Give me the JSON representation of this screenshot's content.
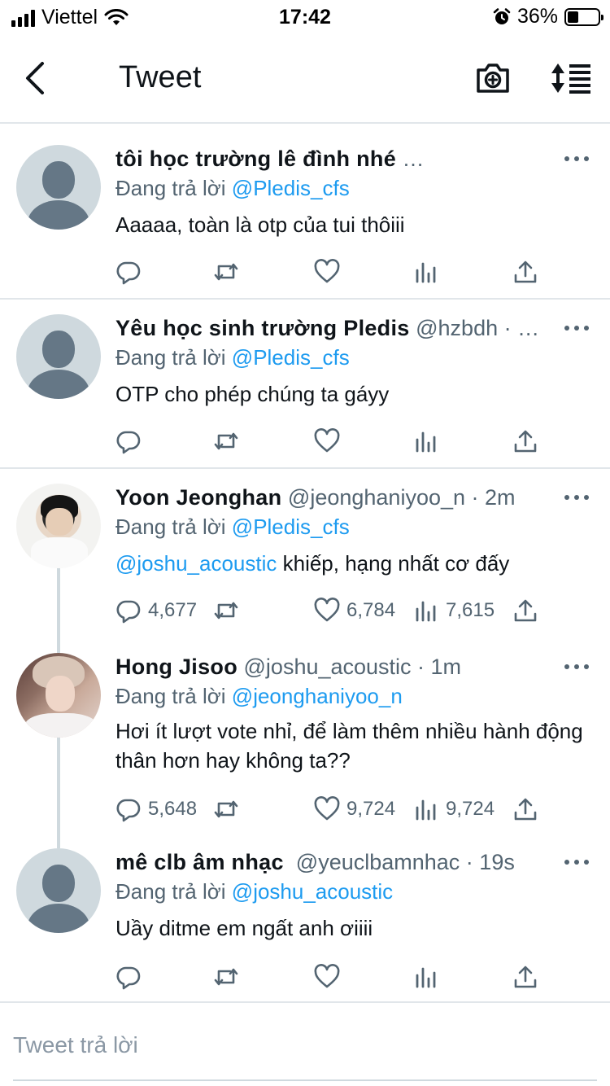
{
  "status_bar": {
    "carrier": "Viettel",
    "time": "17:42",
    "battery_percent": "36%",
    "battery_level": 0.36
  },
  "header": {
    "title": "Tweet",
    "icons": [
      "back-icon",
      "camera-plus-icon",
      "sort-icon"
    ]
  },
  "tweets": [
    {
      "name": "tôi học trường lê đình nhé",
      "handle": "…",
      "reply_prefix": "Đang trả lời",
      "reply_to": "@Pledis_cfs",
      "text": "Aaaaa, toàn là otp của tui thôiii",
      "replies": "",
      "retweets": "",
      "likes": "",
      "views": ""
    },
    {
      "name": "Yêu học sinh trường Pledis",
      "handle": "@hzbdh · …",
      "reply_prefix": "Đang trả lời",
      "reply_to": "@Pledis_cfs",
      "text": "OTP cho phép chúng ta gáyy",
      "replies": "",
      "retweets": "",
      "likes": "",
      "views": ""
    },
    {
      "name": "Yoon Jeonghan",
      "handle": "@jeonghaniyoo_n · 2m",
      "reply_prefix": "Đang trả lời",
      "reply_to": "@Pledis_cfs",
      "text_mention": "@joshu_acoustic",
      "text": " khiếp, hạng nhất cơ đấy",
      "replies": "4,677",
      "retweets": "",
      "likes": "6,784",
      "views": "7,615"
    },
    {
      "name": "Hong Jisoo",
      "handle": "@joshu_acoustic · 1m",
      "reply_prefix": "Đang trả lời",
      "reply_to": "@jeonghaniyoo_n",
      "text": "Hơi ít lượt vote nhỉ, để làm thêm nhiều hành động thân hơn hay không ta??",
      "replies": "5,648",
      "retweets": "",
      "likes": "9,724",
      "views": "9,724"
    },
    {
      "name": "mê clb âm nhạc",
      "handle": "@yeuclbamnhac · 19s",
      "reply_prefix": "Đang trả lời",
      "reply_to": "@joshu_acoustic",
      "text": "Uầy ditme em ngất anh ơiiii",
      "replies": "",
      "retweets": "",
      "likes": "",
      "views": ""
    }
  ],
  "reply_bar": {
    "placeholder": "Tweet trả lời"
  },
  "colors": {
    "accent": "#1d9bf0",
    "secondary_text": "#536471",
    "divider": "#e1e6ea"
  }
}
